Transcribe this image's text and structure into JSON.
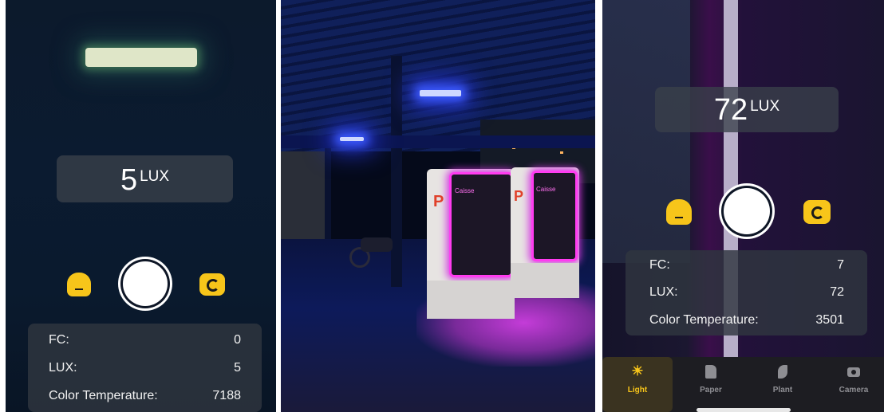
{
  "screen1": {
    "reading": {
      "value": "5",
      "unit": "LUX"
    },
    "stats": [
      {
        "label": "FC:",
        "value": "0"
      },
      {
        "label": "LUX:",
        "value": "5"
      },
      {
        "label": "Color Temperature:",
        "value": "7188"
      }
    ]
  },
  "screen2": {
    "sign_left": "Caisse",
    "sign_right": "Caisse",
    "p_left": "P",
    "p_right": "P"
  },
  "screen3": {
    "reading": {
      "value": "72",
      "unit": "LUX"
    },
    "stats": [
      {
        "label": "FC:",
        "value": "7"
      },
      {
        "label": "LUX:",
        "value": "72"
      },
      {
        "label": "Color Temperature:",
        "value": "3501"
      }
    ],
    "tabs": [
      {
        "label": "Light",
        "icon": "sun-icon",
        "active": true
      },
      {
        "label": "Paper",
        "icon": "paper-icon",
        "active": false
      },
      {
        "label": "Plant",
        "icon": "leaf-icon",
        "active": false
      },
      {
        "label": "Camera",
        "icon": "camera-icon",
        "active": false
      }
    ]
  },
  "colors": {
    "accent": "#f7c51a",
    "tab_inactive": "#8e8e93"
  }
}
